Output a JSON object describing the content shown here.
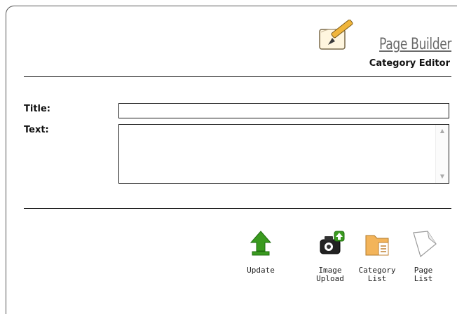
{
  "header": {
    "brand_title": "Page Builder",
    "subtitle": "Category Editor"
  },
  "form": {
    "title_label": "Title:",
    "title_value": "",
    "text_label": "Text:",
    "text_value": ""
  },
  "toolbar": {
    "update_label": "Update",
    "image_upload_label_line1": "Image",
    "image_upload_label_line2": "Upload",
    "category_list_label_line1": "Category",
    "category_list_label_line2": "List",
    "page_list_label_line1": "Page",
    "page_list_label_line2": "List"
  },
  "icons": {
    "brand": "pencil-notepad-icon",
    "update": "upload-arrow-icon",
    "image_upload": "camera-upload-icon",
    "category_list": "folder-list-icon",
    "page_list": "page-icon"
  },
  "colors": {
    "border": "#555555",
    "rule": "#222222",
    "brand_text": "#6b6b6b",
    "update_green": "#3a9a1f",
    "folder_orange": "#f3b45a"
  }
}
